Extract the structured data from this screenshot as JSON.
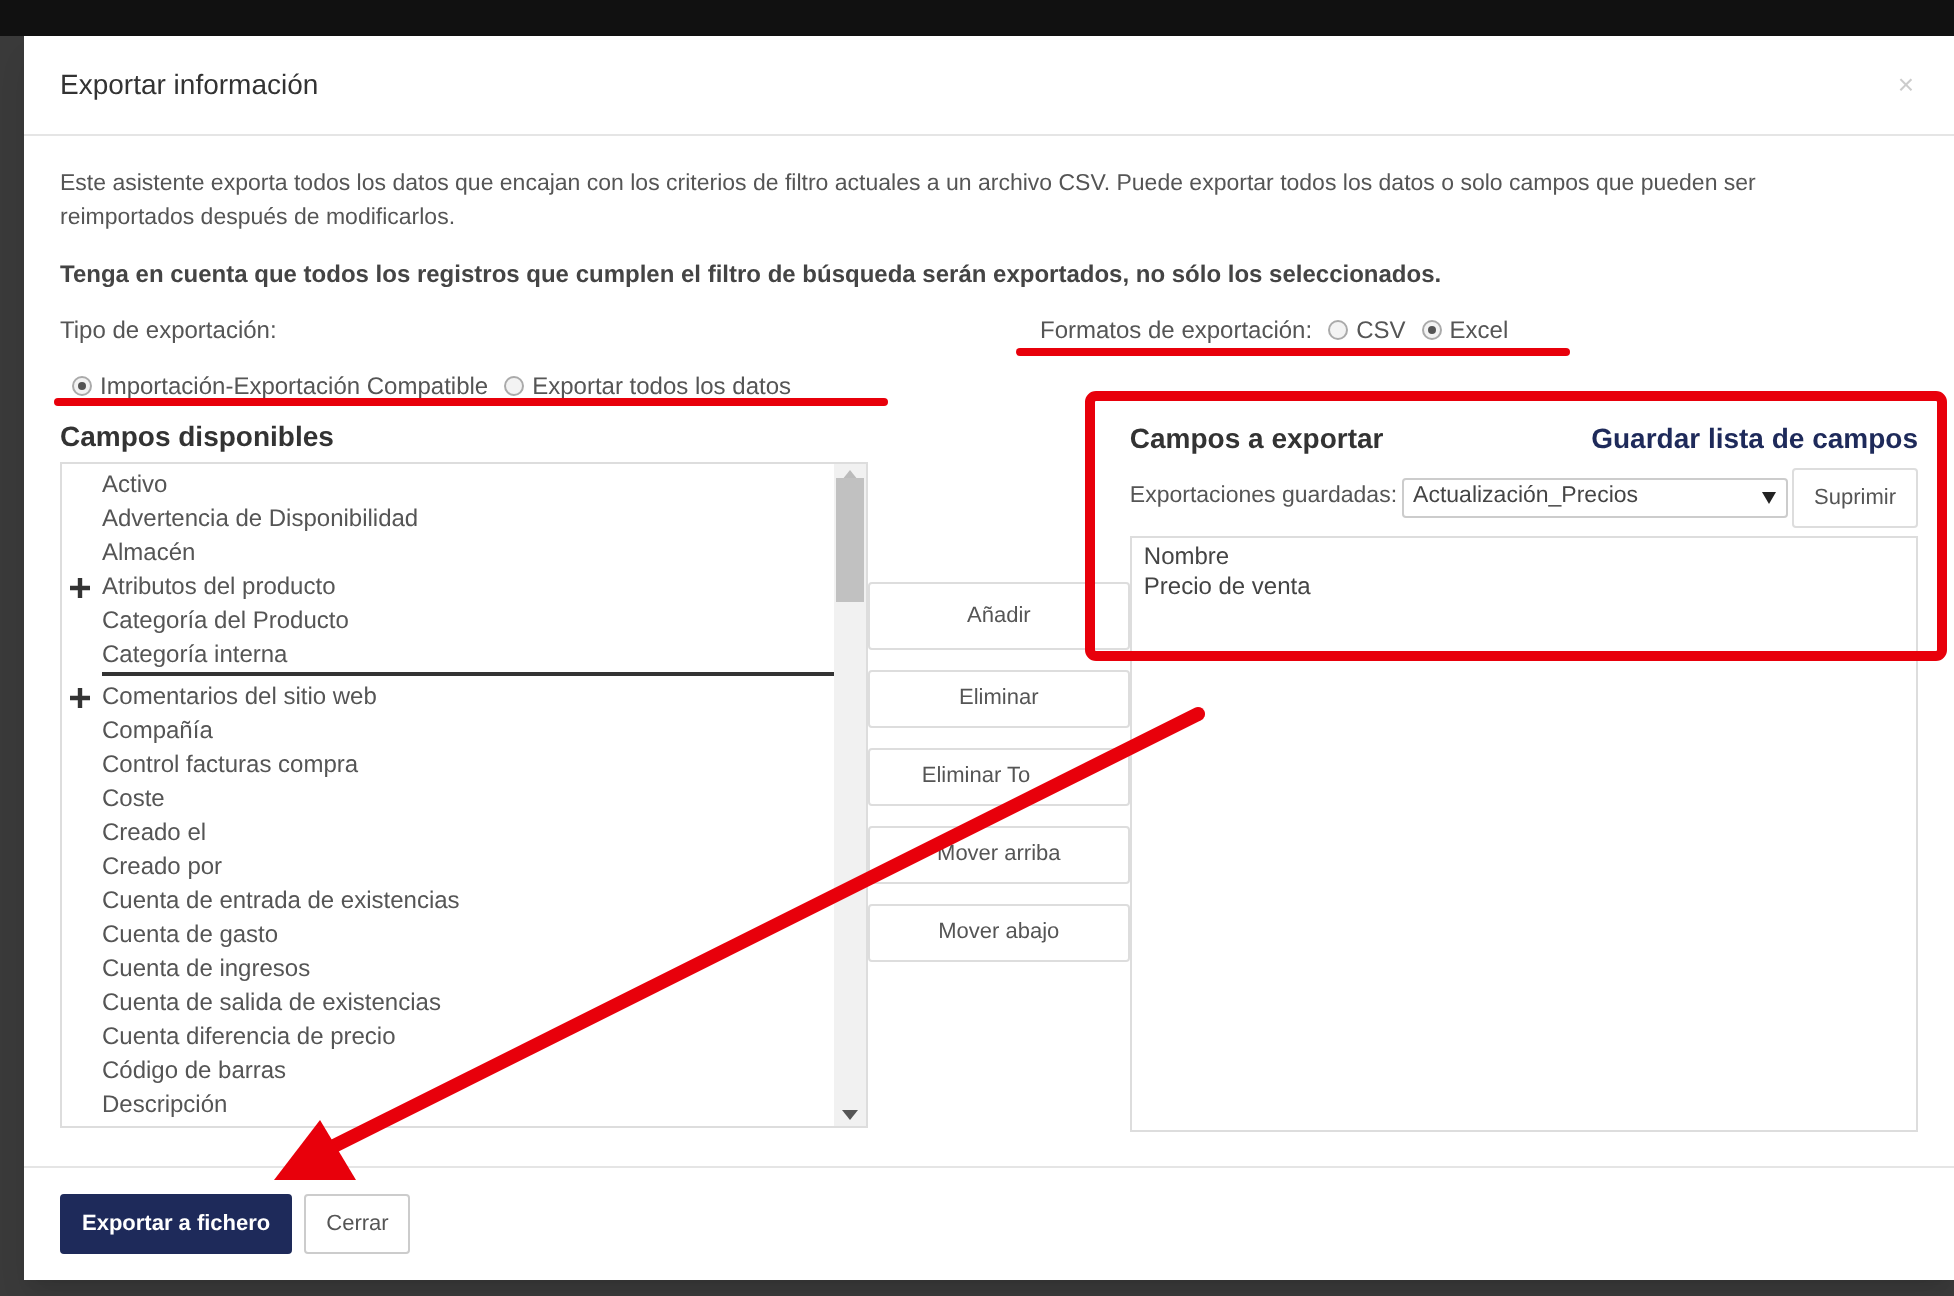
{
  "dialog": {
    "title": "Exportar información",
    "close": "×"
  },
  "intro": "Este asistente exporta todos los datos que encajan con los criterios de filtro actuales a un archivo CSV. Puede exportar todos los datos o solo campos que pueden ser reimportados después de modificarlos.",
  "notice": "Tenga en cuenta que todos los registros que cumplen el filtro de búsqueda serán exportados, no sólo los seleccionados.",
  "export_type": {
    "label": "Tipo de exportación:",
    "options": [
      {
        "label": "Importación-Exportación Compatible",
        "selected": true
      },
      {
        "label": "Exportar todos los datos",
        "selected": false
      }
    ]
  },
  "export_format": {
    "label": "Formatos de exportación:",
    "options": [
      {
        "label": "CSV",
        "selected": false
      },
      {
        "label": "Excel",
        "selected": true
      }
    ]
  },
  "available": {
    "title": "Campos disponibles",
    "items": [
      {
        "label": "Activo",
        "expandable": false,
        "drop_marker": false
      },
      {
        "label": "Advertencia de Disponibilidad",
        "expandable": false,
        "drop_marker": false
      },
      {
        "label": "Almacén",
        "expandable": false,
        "drop_marker": false
      },
      {
        "label": "Atributos del producto",
        "expandable": true,
        "drop_marker": false
      },
      {
        "label": "Categoría del Producto",
        "expandable": false,
        "drop_marker": false
      },
      {
        "label": "Categoría interna",
        "expandable": false,
        "drop_marker": true
      },
      {
        "label": "Comentarios del sitio web",
        "expandable": true,
        "drop_marker": false
      },
      {
        "label": "Compañía",
        "expandable": false,
        "drop_marker": false
      },
      {
        "label": "Control facturas compra",
        "expandable": false,
        "drop_marker": false
      },
      {
        "label": "Coste",
        "expandable": false,
        "drop_marker": false
      },
      {
        "label": "Creado el",
        "expandable": false,
        "drop_marker": false
      },
      {
        "label": "Creado por",
        "expandable": false,
        "drop_marker": false
      },
      {
        "label": "Cuenta de entrada de existencias",
        "expandable": false,
        "drop_marker": false
      },
      {
        "label": "Cuenta de gasto",
        "expandable": false,
        "drop_marker": false
      },
      {
        "label": "Cuenta de ingresos",
        "expandable": false,
        "drop_marker": false
      },
      {
        "label": "Cuenta de salida de existencias",
        "expandable": false,
        "drop_marker": false
      },
      {
        "label": "Cuenta diferencia de precio",
        "expandable": false,
        "drop_marker": false
      },
      {
        "label": "Código de barras",
        "expandable": false,
        "drop_marker": false
      },
      {
        "label": "Descripción",
        "expandable": false,
        "drop_marker": false
      }
    ]
  },
  "actions": [
    "Añadir",
    "Eliminar",
    "Eliminar To",
    "Mover arriba",
    "Mover abajo"
  ],
  "selected_fields": {
    "title": "Campos a exportar",
    "save_link": "Guardar lista de campos",
    "saved_label": "Exportaciones guardadas:",
    "saved_value": "Actualización_Precios",
    "delete_button": "Suprimir",
    "items": [
      "Nombre",
      "Precio de venta"
    ]
  },
  "footer": {
    "buttons": [
      {
        "label": "Exportar a fichero",
        "kind": "primary"
      },
      {
        "label": "Cerrar",
        "kind": "secondary"
      }
    ]
  }
}
